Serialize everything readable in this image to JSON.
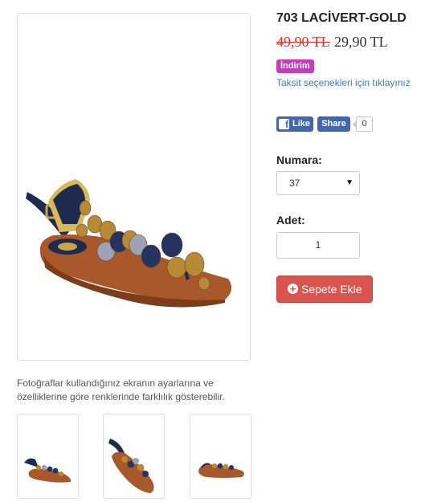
{
  "product": {
    "title": "703 LACİVERT-GOLD",
    "old_price": "49,90 TL",
    "new_price": "29,90 TL",
    "discount_badge": "İndirim",
    "installment_link": "Taksit seçenekleri için tıklayınız"
  },
  "social": {
    "like_label": "Like",
    "share_label": "Share",
    "share_count": "0",
    "brand_color": "#4267b2"
  },
  "options": {
    "size_label": "Numara:",
    "size_value": "37",
    "quantity_label": "Adet:",
    "quantity_value": "1"
  },
  "cart": {
    "add_to_cart_label": "Sepete Ekle",
    "button_color": "#d9534f"
  },
  "gallery": {
    "disclaimer": "Fotoğraflar kullandığınız ekranın ayarlarına ve özelliklerine göre renklerinde farklılık gösterebilir.",
    "thumbnails": [
      "sandal-side-view",
      "sandal-angled-view",
      "sandal-top-view"
    ]
  },
  "colors": {
    "discount_badge": "#c23fb8",
    "old_price": "#d9302b",
    "link": "#3a7dbd",
    "sandal_strap_navy": "#1f2a4f",
    "sandal_sole_tan": "#a8582a",
    "sandal_stone_gold": "#b88a35"
  }
}
